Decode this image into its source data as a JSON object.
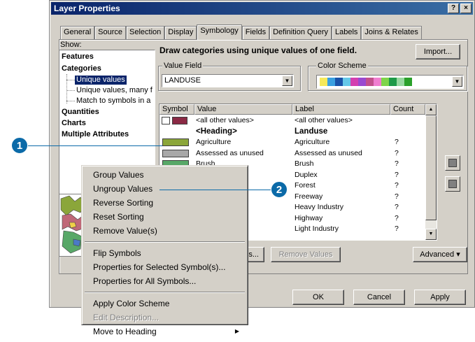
{
  "window": {
    "title": "Layer Properties",
    "help_btn": "?",
    "close_btn": "×"
  },
  "tabs": [
    "General",
    "Source",
    "Selection",
    "Display",
    "Symbology",
    "Fields",
    "Definition Query",
    "Labels",
    "Joins & Relates"
  ],
  "active_tab": "Symbology",
  "show": {
    "label": "Show:",
    "items": [
      "Features",
      "Categories",
      "Unique values",
      "Unique values, many f",
      "Match to symbols in a",
      "Quantities",
      "Charts",
      "Multiple Attributes"
    ]
  },
  "heading": "Draw categories using unique values of one field.",
  "import_btn": "Import...",
  "value_field": {
    "label": "Value Field",
    "value": "LANDUSE"
  },
  "color_scheme": {
    "label": "Color Scheme",
    "colors": [
      "#f6e95a",
      "#3aa0e0",
      "#1a52a8",
      "#66c8e8",
      "#d43fb0",
      "#9a4ad0",
      "#c2508c",
      "#f07ed0",
      "#7ed44a",
      "#1e9a48",
      "#98d8a0",
      "#2aa02a"
    ]
  },
  "table": {
    "headers": [
      "Symbol",
      "Value",
      "Label",
      "Count"
    ],
    "rows": [
      {
        "value": "<all other values>",
        "label": "<all other values>",
        "count": "",
        "color": "#8b2a45",
        "bold": false
      },
      {
        "value": "<Heading>",
        "label": "Landuse",
        "count": "",
        "color": "",
        "bold": true
      },
      {
        "value": "Agriculture",
        "label": "Agriculture",
        "count": "?",
        "color": "#8ba63a",
        "bold": false
      },
      {
        "value": "Assessed as unused",
        "label": "Assessed as unused",
        "count": "?",
        "color": "#a8a8a8",
        "bold": false
      },
      {
        "value": "Brush",
        "label": "Brush",
        "count": "?",
        "color": "#58a868",
        "bold": false
      },
      {
        "value": "Duplex",
        "label": "Duplex",
        "count": "?",
        "color": "",
        "bold": false
      },
      {
        "value": "Forest",
        "label": "Forest",
        "count": "?",
        "color": "",
        "bold": false
      },
      {
        "value": "Freeway",
        "label": "Freeway",
        "count": "?",
        "color": "",
        "bold": false
      },
      {
        "value": "Heavy Industry",
        "label": "Heavy Industry",
        "count": "?",
        "color": "",
        "bold": false
      },
      {
        "value": "Highway",
        "label": "Highway",
        "count": "?",
        "color": "",
        "bold": false
      },
      {
        "value": "Light Industry",
        "label": "Light Industry",
        "count": "?",
        "color": "",
        "bold": false
      }
    ]
  },
  "buttons": {
    "add_values": "Values...",
    "remove_values": "Remove Values",
    "advanced": "Advanced",
    "ok": "OK",
    "cancel": "Cancel",
    "apply": "Apply"
  },
  "context_menu": {
    "group1": [
      "Group Values",
      "Ungroup Values",
      "Reverse Sorting",
      "Reset Sorting",
      "Remove Value(s)"
    ],
    "group2": [
      "Flip Symbols",
      "Properties for Selected Symbol(s)...",
      "Properties for All Symbols..."
    ],
    "group3": [
      "Apply Color Scheme",
      "Edit Description...",
      "Move to Heading"
    ]
  },
  "callouts": [
    "1",
    "2"
  ]
}
